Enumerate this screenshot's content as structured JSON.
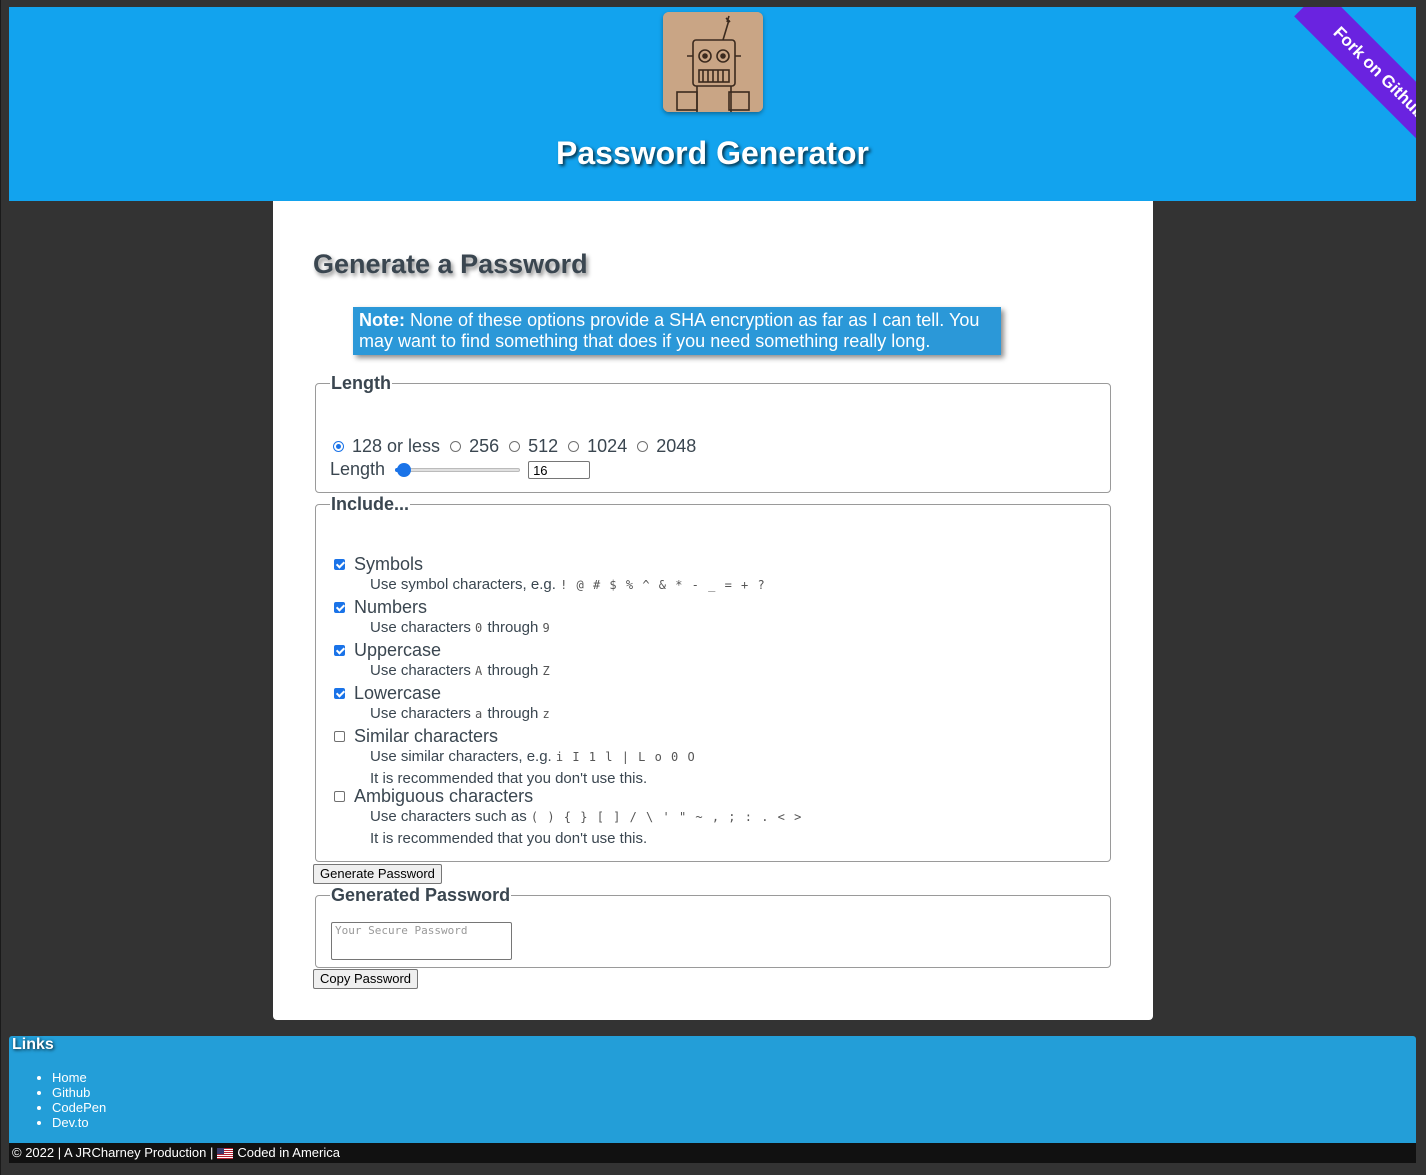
{
  "header": {
    "title": "Password Generator",
    "fork_ribbon": "Fork on Github",
    "logo_icon": "robot-logo-icon"
  },
  "main": {
    "heading": "Generate a Password",
    "note": {
      "label": "Note:",
      "text": " None of these options provide a SHA encryption as far as I can tell. You may want to find something that does if you need something really long."
    },
    "length": {
      "legend": "Length",
      "options": [
        "128 or less",
        "256",
        "512",
        "1024",
        "2048"
      ],
      "selected": "128 or less",
      "slider_label": "Length",
      "value": "16"
    },
    "include": {
      "legend": "Include...",
      "symbols": {
        "label": "Symbols",
        "desc": "Use symbol characters, e.g.",
        "chars": "! @ # $ % ^ & * - _ = + ?",
        "checked": true
      },
      "numbers": {
        "label": "Numbers",
        "desc_pre": "Use characters",
        "from": "0",
        "through": "through",
        "to": "9",
        "checked": true
      },
      "uppercase": {
        "label": "Uppercase",
        "desc_pre": "Use characters",
        "from": "A",
        "through": "through",
        "to": "Z",
        "checked": true
      },
      "lowercase": {
        "label": "Lowercase",
        "desc_pre": "Use characters",
        "from": "a",
        "through": "through",
        "to": "z",
        "checked": true
      },
      "similar": {
        "label": "Similar characters",
        "desc": "Use similar characters, e.g.",
        "chars": "i I 1 l | L o 0 O",
        "warning": "It is recommended that you don't use this.",
        "checked": false
      },
      "ambiguous": {
        "label": "Ambiguous characters",
        "desc": "Use characters such as",
        "chars": "( ) { } [ ] / \\ ' \" ~ , ; : . < >",
        "warning": "It is recommended that you don't use this.",
        "checked": false
      }
    },
    "generate_button": "Generate Password",
    "generated": {
      "legend": "Generated Password",
      "placeholder": "Your Secure Password"
    },
    "copy_button": "Copy Password"
  },
  "footer": {
    "links_title": "Links",
    "links": [
      "Home",
      "Github",
      "CodePen",
      "Dev.to"
    ],
    "copyright_pre": "© 2022 | A JRCharney Production |",
    "copyright_post": "Coded in America"
  },
  "colors": {
    "header_bg": "#12a3ee",
    "ribbon": "#6a23e0",
    "note_bg": "#2b98d8",
    "links_bg": "#239ed8"
  }
}
